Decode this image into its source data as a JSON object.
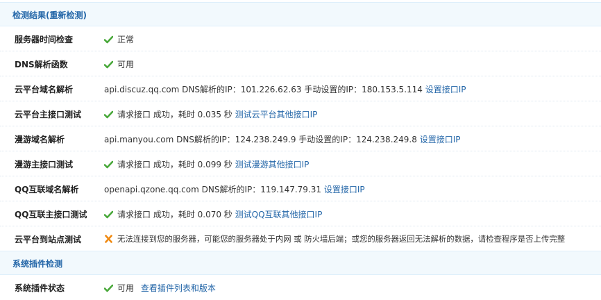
{
  "section1": {
    "title": "检测结果",
    "recheck": "(重新检测)"
  },
  "rows": [
    {
      "label": "服务器时间检查",
      "status": "正常"
    },
    {
      "label": "DNS解析函数",
      "status": "可用"
    },
    {
      "label": "云平台域名解析",
      "text": "api.discuz.qq.com DNS解析的IP：101.226.62.63 手动设置的IP：180.153.5.114",
      "link": "设置接口IP"
    },
    {
      "label": "云平台主接口测试",
      "text": "请求接口 成功，耗时 0.035 秒",
      "link": "测试云平台其他接口IP"
    },
    {
      "label": "漫游域名解析",
      "text": "api.manyou.com DNS解析的IP：124.238.249.9 手动设置的IP：124.238.249.8",
      "link": "设置接口IP"
    },
    {
      "label": "漫游主接口测试",
      "text": "请求接口 成功，耗时 0.099 秒",
      "link": "测试漫游其他接口IP"
    },
    {
      "label": "QQ互联域名解析",
      "text": "openapi.qzone.qq.com DNS解析的IP：119.147.79.31",
      "link": "设置接口IP"
    },
    {
      "label": "QQ互联主接口测试",
      "text": "请求接口 成功，耗时 0.070 秒",
      "link": "测试QQ互联其他接口IP"
    },
    {
      "label": "云平台到站点测试",
      "text": "无法连接到您的服务器，可能您的服务器处于内网 或 防火墙后端；或您的服务器返回无法解析的数据，请检查程序是否上传完整"
    }
  ],
  "section2": {
    "title": "系统插件检测"
  },
  "plugin_row": {
    "label": "系统插件状态",
    "status": "可用",
    "link": "查看插件列表和版本"
  },
  "colors": {
    "ok": "#49a83a",
    "error": "#f08a12",
    "link": "#2366a8",
    "header_bg": "#f2f9fd"
  }
}
